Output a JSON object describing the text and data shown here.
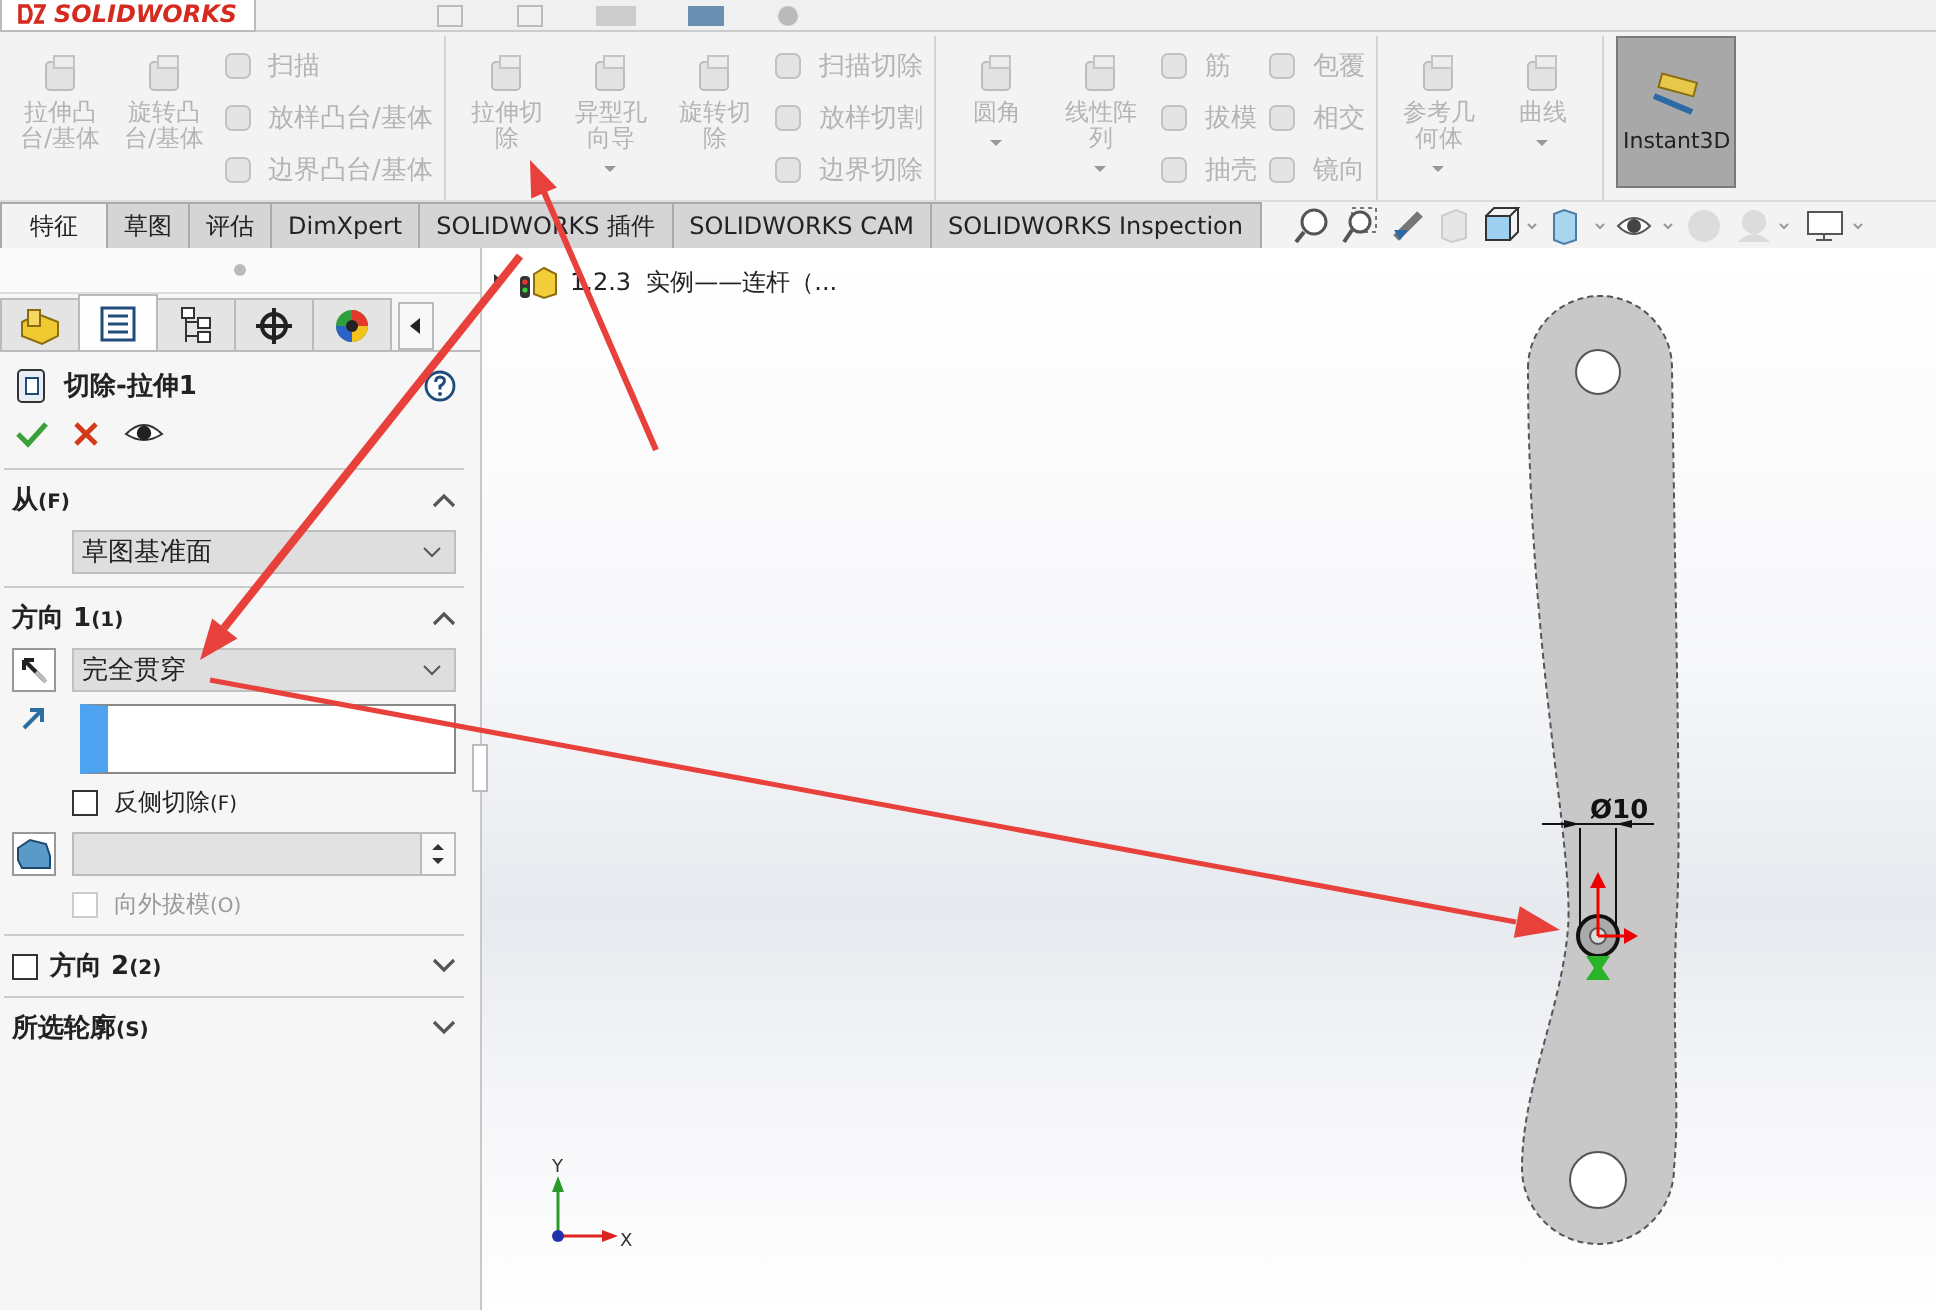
{
  "app": {
    "logo": "SOLIDWORKS"
  },
  "ribbon": {
    "groups": [
      {
        "items": [
          {
            "kind": "large",
            "label": "拉伸凸台/基体",
            "disabled": true,
            "dropdown": false
          },
          {
            "kind": "large",
            "label": "旋转凸台/基体",
            "disabled": true,
            "dropdown": false
          },
          {
            "kind": "stack",
            "items": [
              {
                "label": "扫描",
                "disabled": true
              },
              {
                "label": "放样凸台/基体",
                "disabled": true
              },
              {
                "label": "边界凸台/基体",
                "disabled": true
              }
            ]
          }
        ]
      },
      {
        "items": [
          {
            "kind": "large",
            "label": "拉伸切除",
            "disabled": true,
            "dropdown": false
          },
          {
            "kind": "large",
            "label": "异型孔向导",
            "disabled": true,
            "dropdown": true
          },
          {
            "kind": "large",
            "label": "旋转切除",
            "disabled": true,
            "dropdown": false
          },
          {
            "kind": "stack",
            "items": [
              {
                "label": "扫描切除",
                "disabled": true
              },
              {
                "label": "放样切割",
                "disabled": true
              },
              {
                "label": "边界切除",
                "disabled": true
              }
            ]
          }
        ]
      },
      {
        "items": [
          {
            "kind": "large",
            "label": "圆角",
            "disabled": true,
            "dropdown": true
          },
          {
            "kind": "large",
            "label": "线性阵列",
            "disabled": true,
            "dropdown": true
          },
          {
            "kind": "stack",
            "items": [
              {
                "label": "筋",
                "disabled": true
              },
              {
                "label": "拔模",
                "disabled": true
              },
              {
                "label": "抽壳",
                "disabled": true
              }
            ]
          },
          {
            "kind": "stack",
            "items": [
              {
                "label": "包覆",
                "disabled": true
              },
              {
                "label": "相交",
                "disabled": true
              },
              {
                "label": "镜向",
                "disabled": true
              }
            ]
          }
        ]
      },
      {
        "items": [
          {
            "kind": "large",
            "label": "参考几何体",
            "disabled": true,
            "dropdown": true
          },
          {
            "kind": "large",
            "label": "曲线",
            "disabled": true,
            "dropdown": true
          }
        ]
      },
      {
        "items": [
          {
            "kind": "toggle",
            "label": "Instant3D",
            "selected": true
          }
        ]
      }
    ]
  },
  "tabs": [
    {
      "label": "特征",
      "selected": true
    },
    {
      "label": "草图",
      "selected": false
    },
    {
      "label": "评估",
      "selected": false
    },
    {
      "label": "DimXpert",
      "selected": false
    },
    {
      "label": "SOLIDWORKS 插件",
      "selected": false
    },
    {
      "label": "SOLIDWORKS CAM",
      "selected": false
    },
    {
      "label": "SOLIDWORKS Inspection",
      "selected": false
    }
  ],
  "panel": {
    "tabs": [
      {
        "selected": false
      },
      {
        "selected": true
      },
      {
        "selected": false
      },
      {
        "selected": false
      },
      {
        "selected": false
      }
    ],
    "title": "切除-拉伸1",
    "sections": [
      {
        "kind": "from",
        "title": "从",
        "hotkey": "(F)",
        "expanded": true,
        "select": "草图基准面"
      },
      {
        "kind": "direction",
        "title": "方向 1",
        "hotkey": "(1)",
        "expanded": true,
        "select": "完全贯穿",
        "flip": {
          "label": "反侧切除",
          "hotkey": "(F)",
          "checked": false
        },
        "draft": {
          "label": "向外拔模",
          "hotkey": "(O)",
          "checked": false,
          "disabled": true
        }
      },
      {
        "kind": "optional",
        "title": "方向 2",
        "hotkey": "(2)",
        "expanded": false,
        "checked": false
      },
      {
        "kind": "plain",
        "title": "所选轮廓",
        "hotkey": "(S)",
        "expanded": false
      }
    ]
  },
  "canvas": {
    "tree_item": "1.2.3  实例——连杆（...",
    "dimension": "Ø10",
    "axes": [
      "Y",
      "X"
    ]
  }
}
